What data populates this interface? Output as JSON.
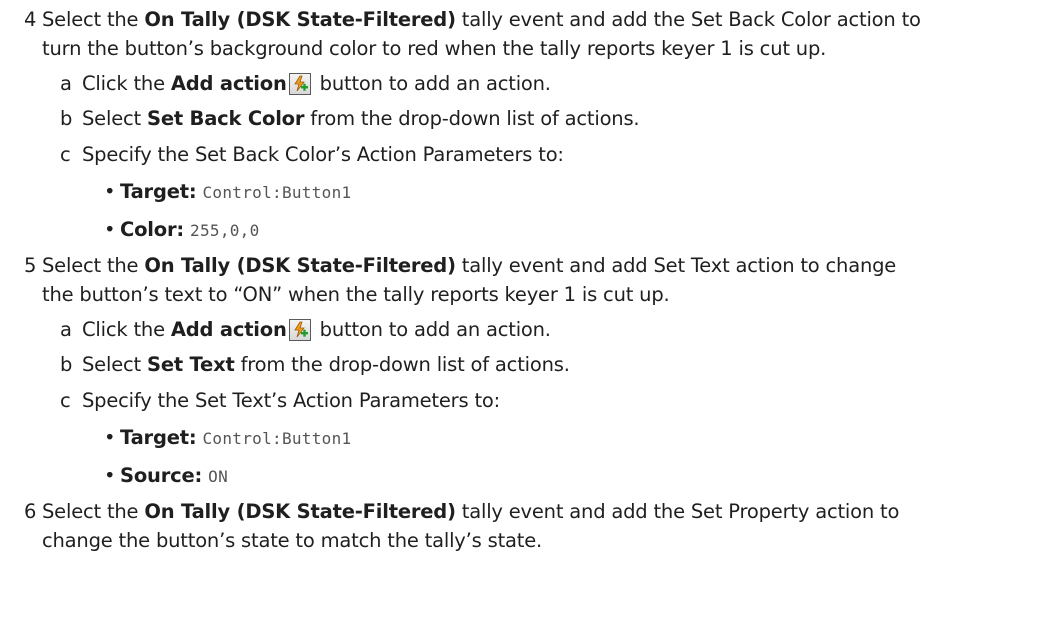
{
  "steps": [
    {
      "number": "4",
      "line1_pre": "Select the ",
      "line1_bold": "On Tally (DSK State-Filtered)",
      "line1_post": " tally event and add the Set Back Color action to",
      "line2": "turn the button’s background color to red when the tally reports keyer 1 is cut up.",
      "subs": [
        {
          "letter": "a",
          "pre": "Click the ",
          "bold": "Add action",
          "post": " button to add an action.",
          "icon": "add-action-icon"
        },
        {
          "letter": "b",
          "pre": "Select ",
          "bold": "Set Back Color",
          "post": " from the drop-down list of actions."
        },
        {
          "letter": "c",
          "text": "Specify the Set Back Color’s Action Parameters to:"
        }
      ],
      "params": [
        {
          "label": "Target",
          "value": "Control:Button1"
        },
        {
          "label": "Color",
          "value": "255,0,0"
        }
      ]
    },
    {
      "number": "5",
      "line1_pre": "Select the ",
      "line1_bold": "On Tally (DSK State-Filtered)",
      "line1_post": " tally event and add Set Text action to change",
      "line2": "the button’s text to “ON” when the tally reports keyer 1 is cut up.",
      "subs": [
        {
          "letter": "a",
          "pre": "Click the ",
          "bold": "Add action",
          "post": " button to add an action.",
          "icon": "add-action-icon"
        },
        {
          "letter": "b",
          "pre": "Select ",
          "bold": "Set Text",
          "post": " from the drop-down list of actions."
        },
        {
          "letter": "c",
          "text": "Specify the Set Text’s Action Parameters to:"
        }
      ],
      "params": [
        {
          "label": "Target",
          "value": "Control:Button1"
        },
        {
          "label": "Source",
          "value": "ON"
        }
      ]
    },
    {
      "number": "6",
      "line1_pre": "Select the ",
      "line1_bold": "On Tally (DSK State-Filtered)",
      "line1_post": " tally event and add the Set Property action to",
      "line2": "change the button’s state to match the tally’s state."
    }
  ],
  "bullet_char": "•",
  "colon": ":"
}
